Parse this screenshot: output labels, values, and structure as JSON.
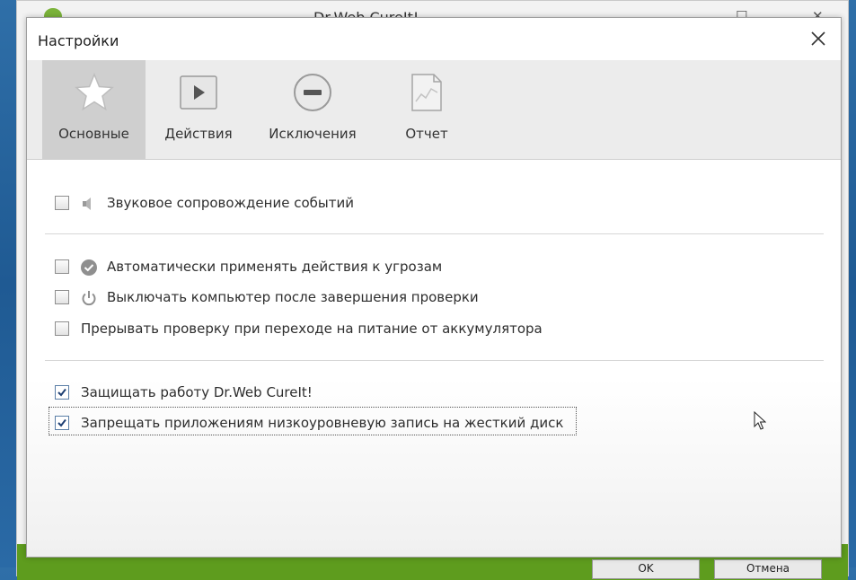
{
  "background_window": {
    "title": "Dr.Web CureIt!",
    "ok_label": "OK",
    "cancel_label": "Отмена",
    "footer_color": "#5e9c1e"
  },
  "dialog": {
    "title": "Настройки",
    "close_icon": "close-icon"
  },
  "tabs": [
    {
      "label": "Основные",
      "icon": "star-icon",
      "active": true
    },
    {
      "label": "Действия",
      "icon": "play-icon",
      "active": false
    },
    {
      "label": "Исключения",
      "icon": "minus-circle-icon",
      "active": false
    },
    {
      "label": "Отчет",
      "icon": "report-icon",
      "active": false
    }
  ],
  "options": [
    {
      "label": "Звуковое сопровождение событий",
      "checked": false,
      "icon": "speaker-icon"
    },
    {
      "label": "Автоматически применять действия к угрозам",
      "checked": false,
      "icon": "check-circle-icon"
    },
    {
      "label": "Выключать компьютер после завершения проверки",
      "checked": false,
      "icon": "power-icon"
    },
    {
      "label": "Прерывать проверку при переходе на питание от аккумулятора",
      "checked": false,
      "icon": ""
    },
    {
      "label": "Защищать работу Dr.Web CureIt!",
      "checked": true,
      "icon": ""
    },
    {
      "label": "Запрещать приложениям низкоуровневую запись на жесткий диск",
      "checked": true,
      "icon": "",
      "focused": true
    }
  ]
}
